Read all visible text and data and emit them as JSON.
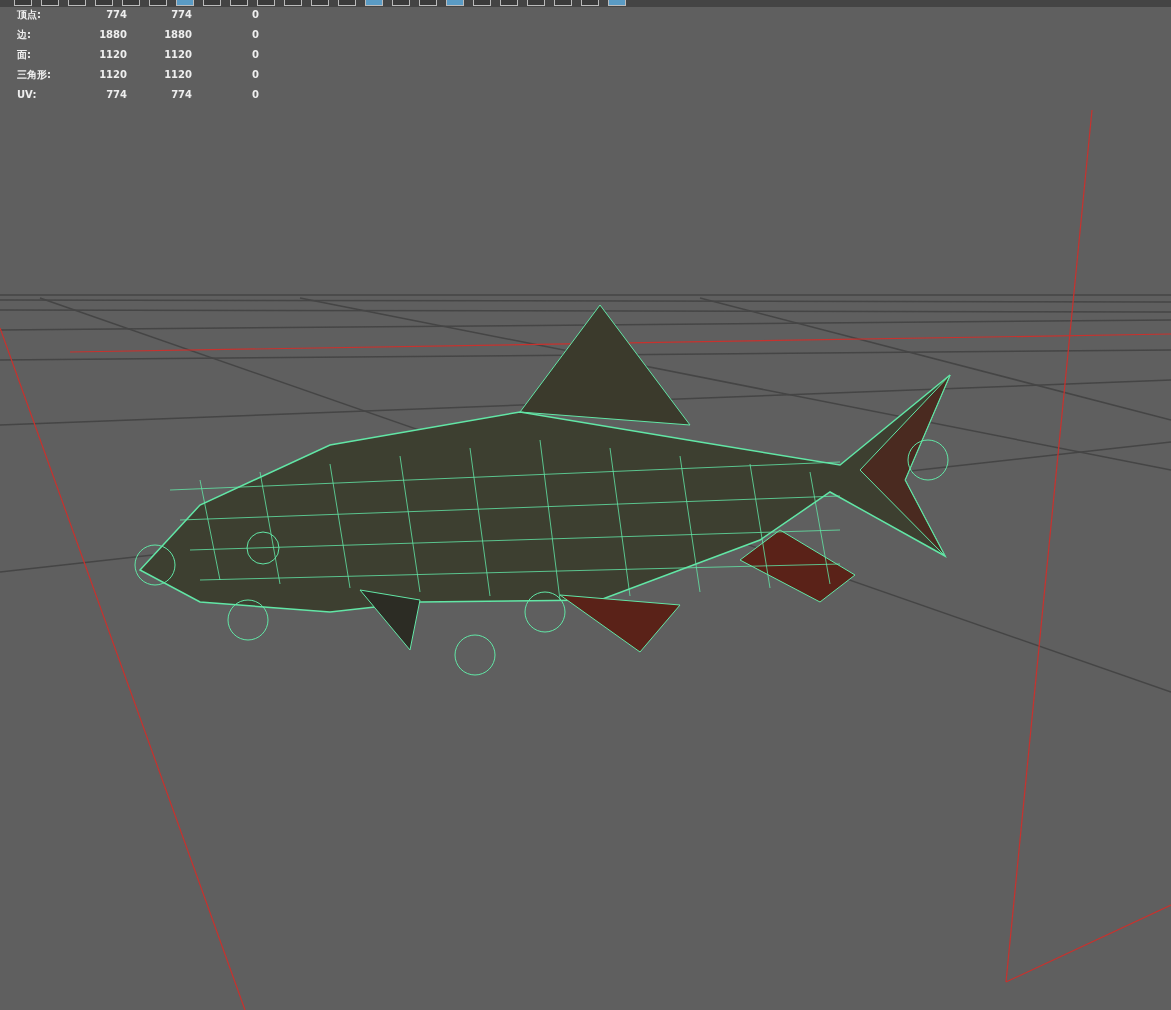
{
  "toolbar": {
    "buttons": [
      {
        "selected": false
      },
      {
        "selected": false
      },
      {
        "selected": false
      },
      {
        "selected": false
      },
      {
        "selected": false
      },
      {
        "selected": false
      },
      {
        "selected": true
      },
      {
        "selected": false
      },
      {
        "selected": false
      },
      {
        "selected": false
      },
      {
        "selected": false
      },
      {
        "selected": false
      },
      {
        "selected": false
      },
      {
        "selected": true
      },
      {
        "selected": false
      },
      {
        "selected": false
      },
      {
        "selected": true
      },
      {
        "selected": false
      },
      {
        "selected": false
      },
      {
        "selected": false
      },
      {
        "selected": false
      },
      {
        "selected": false
      },
      {
        "selected": true
      }
    ]
  },
  "hud": {
    "rows": [
      {
        "label": "顶点:",
        "values": [
          "774",
          "774",
          "0"
        ]
      },
      {
        "label": "边:",
        "values": [
          "1880",
          "1880",
          "0"
        ]
      },
      {
        "label": "面:",
        "values": [
          "1120",
          "1120",
          "0"
        ]
      },
      {
        "label": "三角形:",
        "values": [
          "1120",
          "1120",
          "0"
        ]
      },
      {
        "label": "UV:",
        "values": [
          "774",
          "774",
          "0"
        ]
      }
    ]
  }
}
